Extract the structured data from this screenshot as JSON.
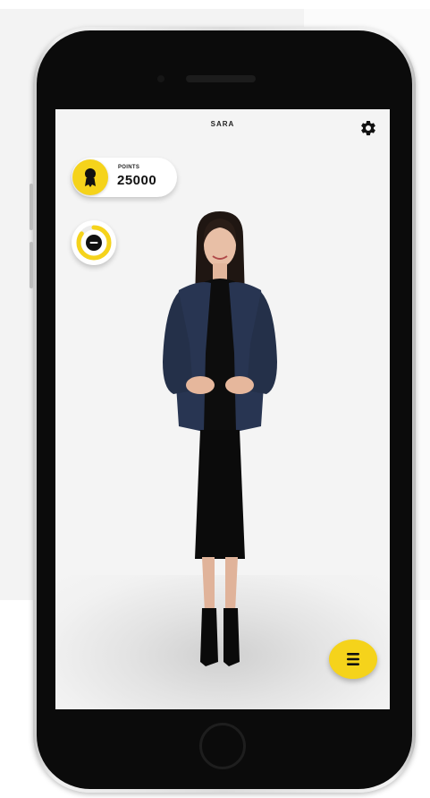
{
  "app": {
    "title": "SARA"
  },
  "points": {
    "label": "POINTS",
    "value": "25000"
  },
  "progress": {
    "fraction": 0.85
  },
  "icons": {
    "settings": "gear-icon",
    "points_badge": "award-medal-icon",
    "progress": "avatar-face-icon",
    "menu": "hamburger-menu-icon"
  },
  "colors": {
    "accent": "#f5d31b",
    "screen_bg": "#f4f4f4",
    "text": "#111111"
  }
}
